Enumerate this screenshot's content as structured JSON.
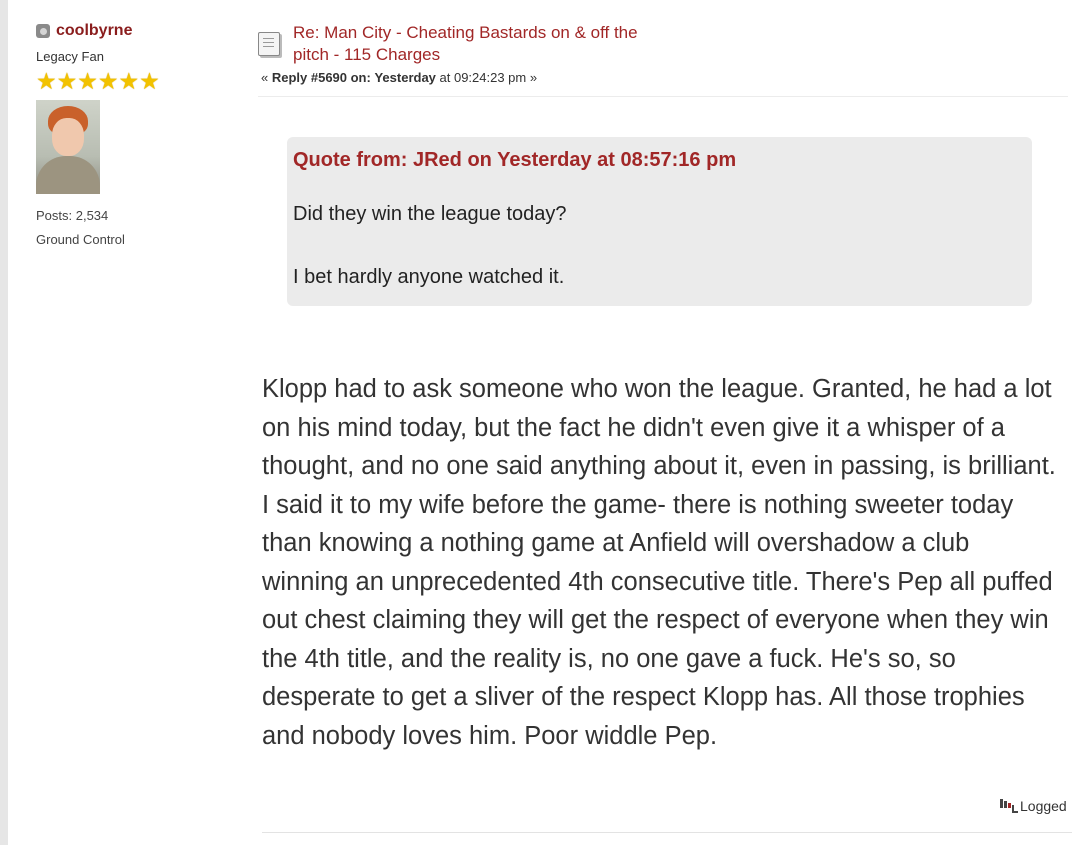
{
  "poster": {
    "username": "coolbyrne",
    "rank": "Legacy Fan",
    "star_count": 6,
    "star_glyph": "★",
    "posts": "Posts: 2,534",
    "location": "Ground Control"
  },
  "header": {
    "subject": "Re: Man City - Cheating Bastards on & off the pitch - 115 Charges",
    "reply_prefix": "« ",
    "reply_label": "Reply #5690 on:",
    "reply_day": "Yesterday",
    "reply_time": " at 09:24:23 pm »"
  },
  "quote": {
    "header": "Quote from: JRed on Yesterday at 08:57:16 pm",
    "line1": "Did they win the league today?",
    "line2": "I bet hardly anyone watched it."
  },
  "body": {
    "text": "Klopp had to ask someone who won the league. Granted, he had a lot on his mind today, but the fact he didn't even give it a whisper of a thought, and no one said anything about it, even in passing, is brilliant. I said it to my wife before the game- there is nothing sweeter today than knowing a nothing game at Anfield will overshadow a club winning an unprecedented 4th consecutive title. There's Pep all puffed out chest claiming they will get the respect of everyone when they win the 4th title, and the reality is, no one gave a fuck. He's so, so desperate to get a sliver of the respect Klopp has. All those trophies and nobody loves him. Poor widdle Pep."
  },
  "footer": {
    "logged": "Logged"
  },
  "colors": {
    "link": "#a12727",
    "username": "#8a1d1d",
    "quote_bg": "#ebebeb",
    "star": "#f2c200"
  },
  "icons": {
    "status": "offline-status-icon",
    "topic": "document-icon",
    "logged": "ip-logged-icon"
  }
}
